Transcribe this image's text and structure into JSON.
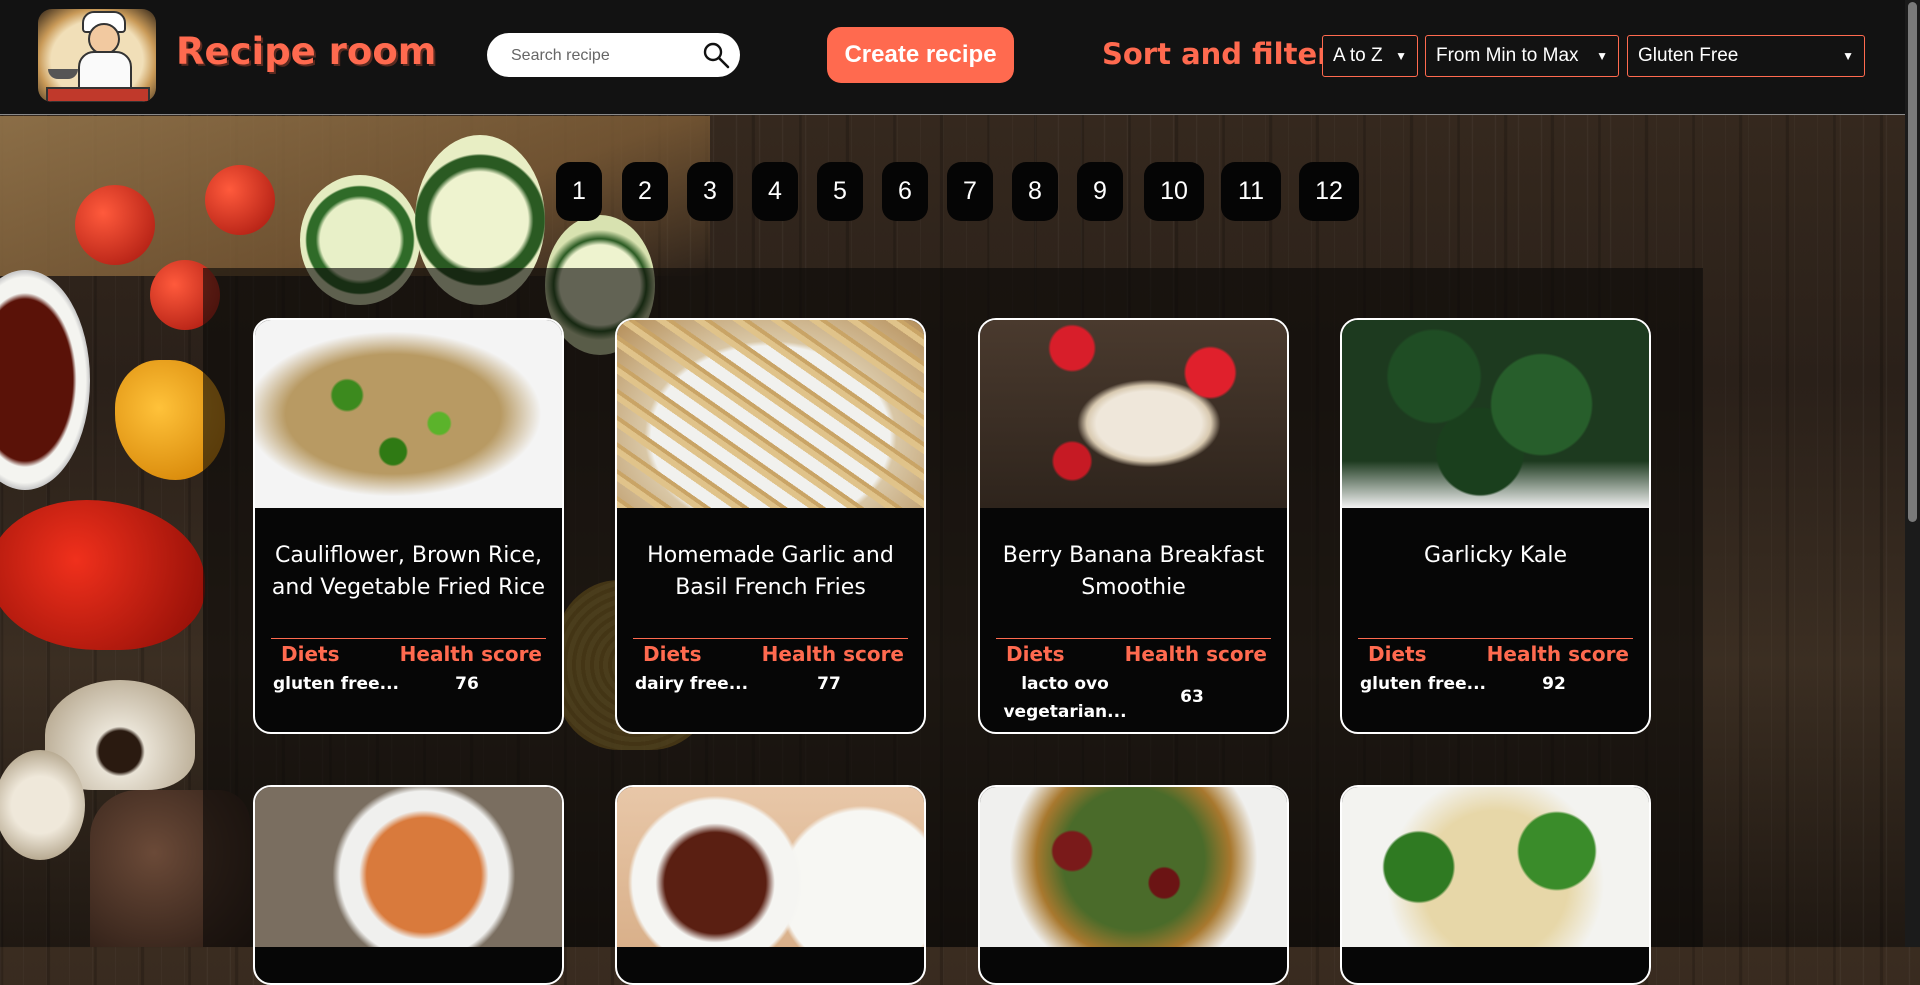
{
  "header": {
    "brand": "Recipe room",
    "search_placeholder": "Search recipe",
    "create_button": "Create recipe",
    "sort_label": "Sort and filter:",
    "sort_order": "A to Z",
    "score_order": "From Min to Max",
    "diet_filter": "Gluten Free"
  },
  "pagination": [
    "1",
    "2",
    "3",
    "4",
    "5",
    "6",
    "7",
    "8",
    "9",
    "10",
    "11",
    "12"
  ],
  "cards": [
    {
      "title": "Cauliflower, Brown Rice, and Vegetable Fried Rice",
      "diets": "gluten free...",
      "health_score": "76"
    },
    {
      "title": "Homemade Garlic and Basil French Fries",
      "diets": "dairy free...",
      "health_score": "77"
    },
    {
      "title": "Berry Banana Breakfast Smoothie",
      "diets": "lacto ovo vegetarian...",
      "health_score": "63"
    },
    {
      "title": "Garlicky Kale",
      "diets": "gluten free...",
      "health_score": "92"
    }
  ],
  "labels": {
    "diets": "Diets",
    "health_score": "Health score"
  },
  "colors": {
    "accent": "#ff6a4f",
    "header_bg": "#121212",
    "card_bg": "#060606"
  }
}
